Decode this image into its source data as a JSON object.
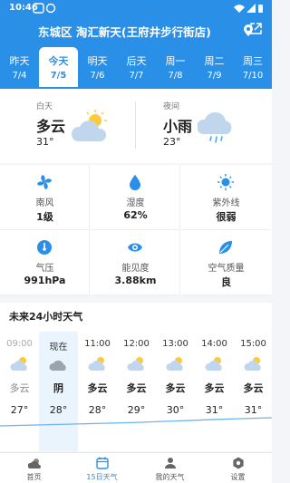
{
  "status": {
    "time": "10:46"
  },
  "header": {
    "location": "东城区 淘汇新天(王府井步行街店)"
  },
  "days": [
    {
      "name": "昨天",
      "date": "7/4"
    },
    {
      "name": "今天",
      "date": "7/5"
    },
    {
      "name": "明天",
      "date": "7/6"
    },
    {
      "name": "后天",
      "date": "7/7"
    },
    {
      "name": "周一",
      "date": "7/8"
    },
    {
      "name": "周二",
      "date": "7/9"
    },
    {
      "name": "周三",
      "date": "7/10"
    }
  ],
  "today": {
    "day": {
      "label": "白天",
      "condition": "多云",
      "temp": "31°",
      "icon": "partly-cloudy-icon"
    },
    "night": {
      "label": "夜间",
      "condition": "小雨",
      "temp": "23°",
      "icon": "light-rain-icon"
    }
  },
  "details": [
    {
      "label": "南风",
      "value": "1级",
      "icon": "wind-icon"
    },
    {
      "label": "湿度",
      "value": "62%",
      "icon": "humidity-icon"
    },
    {
      "label": "紫外线",
      "value": "很弱",
      "icon": "uv-icon"
    },
    {
      "label": "气压",
      "value": "991hPa",
      "icon": "pressure-icon"
    },
    {
      "label": "能见度",
      "value": "3.88km",
      "icon": "visibility-icon"
    },
    {
      "label": "空气质量",
      "value": "良",
      "icon": "air-quality-icon"
    }
  ],
  "hourly": {
    "title": "未来24小时天气",
    "items": [
      {
        "time": "09:00",
        "cond": "多云",
        "temp": "27°"
      },
      {
        "time": "现在",
        "cond": "阴",
        "temp": "28°"
      },
      {
        "time": "11:00",
        "cond": "多云",
        "temp": "28°"
      },
      {
        "time": "12:00",
        "cond": "多云",
        "temp": "29°"
      },
      {
        "time": "13:00",
        "cond": "多云",
        "temp": "30°"
      },
      {
        "time": "14:00",
        "cond": "多云",
        "temp": "31°"
      },
      {
        "time": "15:00",
        "cond": "多云",
        "temp": "31°"
      }
    ]
  },
  "nav": [
    {
      "label": "首页",
      "icon": "home-weather-icon"
    },
    {
      "label": "15日天气",
      "icon": "calendar-icon"
    },
    {
      "label": "我的天气",
      "icon": "user-icon"
    },
    {
      "label": "设置",
      "icon": "settings-icon"
    }
  ],
  "colors": {
    "primary": "#2a8fe6",
    "background": "#f3f5f8"
  }
}
